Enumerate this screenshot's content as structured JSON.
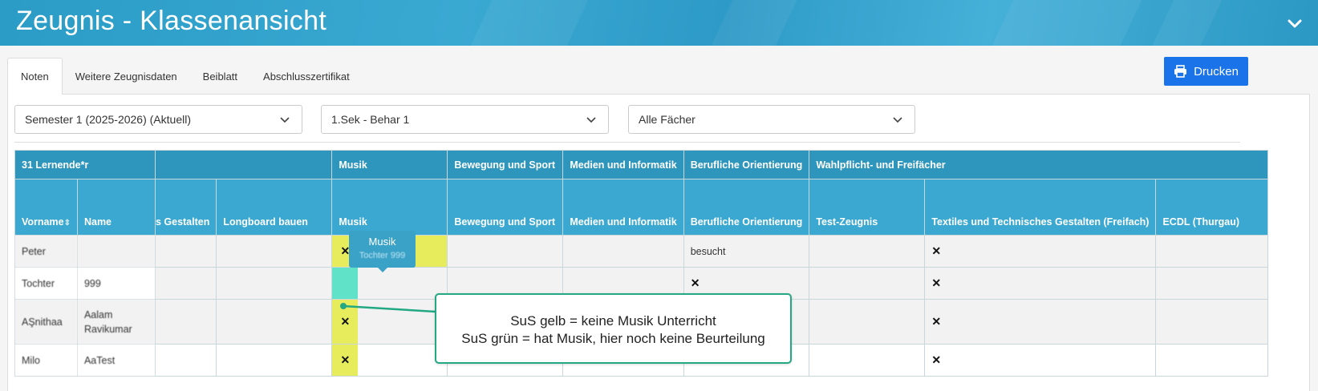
{
  "header": {
    "title": "Zeugnis - Klassenansicht"
  },
  "tabs": [
    "Noten",
    "Weitere Zeugnisdaten",
    "Beiblatt",
    "Abschlusszertifikat"
  ],
  "print_button": {
    "label": "Drucken"
  },
  "selects": {
    "semester": "Semester 1 (2025-2026) (Aktuell)",
    "klasse": "1.Sek - Behar 1",
    "faecher": "Alle Fächer"
  },
  "table": {
    "group_headers": [
      "31 Lernende*r",
      "",
      "Musik",
      "Bewegung und Sport",
      "Medien und Informatik",
      "Berufliche Orientierung",
      "Wahlpflicht- und Freifächer"
    ],
    "column_headers": [
      "Vorname",
      "Name",
      "s Gestalten",
      "Longboard bauen",
      "Musik",
      "Bewegung und Sport",
      "Medien und Informatik",
      "Berufliche Orientierung",
      "Test-Zeugnis",
      "Textiles und Technisches Gestalten (Freifach)",
      "ECDL (Thurgau)"
    ],
    "rows": [
      {
        "vorname": "Peter",
        "name": "",
        "musik": "✕",
        "beruf": "besucht",
        "textil": "✕"
      },
      {
        "vorname": "Tochter",
        "name": "999",
        "musik": "",
        "beruf": "✕",
        "textil": "✕"
      },
      {
        "vorname": "AŞnithaa",
        "name": "Aalam Ravikumar",
        "musik": "✕",
        "beruf": "",
        "textil": "✕"
      },
      {
        "vorname": "Milo",
        "name": "AaTest",
        "musik": "✕",
        "beruf": "",
        "textil": "✕"
      }
    ],
    "highlight_colors": {
      "yellow": "#e6ec5c",
      "green": "#5fe2c8"
    }
  },
  "tooltip": {
    "title": "Musik",
    "subtitle": "Tochter 999"
  },
  "callout": {
    "line1": "SuS gelb = keine Musik Unterricht",
    "line2": "SuS grün = hat Musik, hier noch keine Beurteilung"
  },
  "colors": {
    "header": "#2e95bd",
    "subheader": "#3aa8d0",
    "primary_button": "#1a73e8",
    "callout_border": "#22a883"
  }
}
